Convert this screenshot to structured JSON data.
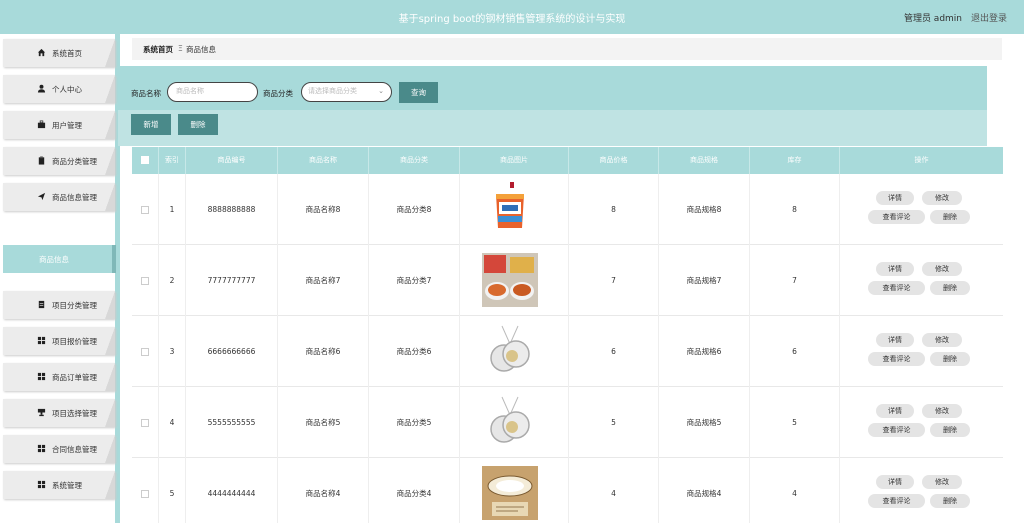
{
  "header": {
    "title": "基于spring boot的钢材销售管理系统的设计与实现",
    "admin_label": "管理员 admin",
    "logout_label": "退出登录"
  },
  "sidebar": {
    "items": [
      {
        "label": "系统首页",
        "icon": "home-icon"
      },
      {
        "label": "个人中心",
        "icon": "user-icon"
      },
      {
        "label": "用户管理",
        "icon": "briefcase-icon"
      },
      {
        "label": "商品分类管理",
        "icon": "clipboard-icon"
      },
      {
        "label": "商品信息管理",
        "icon": "send-icon"
      },
      {
        "label": "项目分类管理",
        "icon": "file-icon"
      },
      {
        "label": "项目报价管理",
        "icon": "grid-icon"
      },
      {
        "label": "商品订单管理",
        "icon": "grid-icon"
      },
      {
        "label": "项目选择管理",
        "icon": "trophy-icon"
      },
      {
        "label": "合同信息管理",
        "icon": "grid-icon"
      },
      {
        "label": "系统管理",
        "icon": "grid-icon"
      }
    ],
    "active_sub": "商品信息"
  },
  "breadcrumb": {
    "home": "系统首页",
    "current": "商品信息"
  },
  "search": {
    "name_label": "商品名称",
    "name_placeholder": "商品名称",
    "category_label": "商品分类",
    "category_placeholder": "请选择商品分类",
    "query_button": "查询",
    "add_button": "新增",
    "delete_button": "删除"
  },
  "table": {
    "columns": [
      "索引",
      "商品编号",
      "商品名称",
      "商品分类",
      "商品图片",
      "商品价格",
      "商品规格",
      "库存",
      "操作"
    ],
    "rows": [
      {
        "index": "1",
        "code": "8888888888",
        "name": "商品名称8",
        "category": "商品分类8",
        "image": "paint-bucket",
        "price": "8",
        "spec": "商品规格8",
        "stock": "8"
      },
      {
        "index": "2",
        "code": "7777777777",
        "name": "商品名称7",
        "category": "商品分类7",
        "image": "food-bowls",
        "price": "7",
        "spec": "商品规格7",
        "stock": "7"
      },
      {
        "index": "3",
        "code": "6666666666",
        "name": "商品名称6",
        "category": "商品分类6",
        "image": "pendant",
        "price": "6",
        "spec": "商品规格6",
        "stock": "6"
      },
      {
        "index": "4",
        "code": "5555555555",
        "name": "商品名称5",
        "category": "商品分类5",
        "image": "pendant",
        "price": "5",
        "spec": "商品规格5",
        "stock": "5"
      },
      {
        "index": "5",
        "code": "4444444444",
        "name": "商品名称4",
        "category": "商品分类4",
        "image": "ceiling-lamp",
        "price": "4",
        "spec": "商品规格4",
        "stock": "4"
      }
    ],
    "actions": {
      "detail": "详情",
      "edit": "修改",
      "reviews": "查看评论",
      "delete": "删除"
    }
  },
  "colors": {
    "accent": "#a8dada",
    "button": "#4a8a8a",
    "menu_bg": "#ececec"
  }
}
